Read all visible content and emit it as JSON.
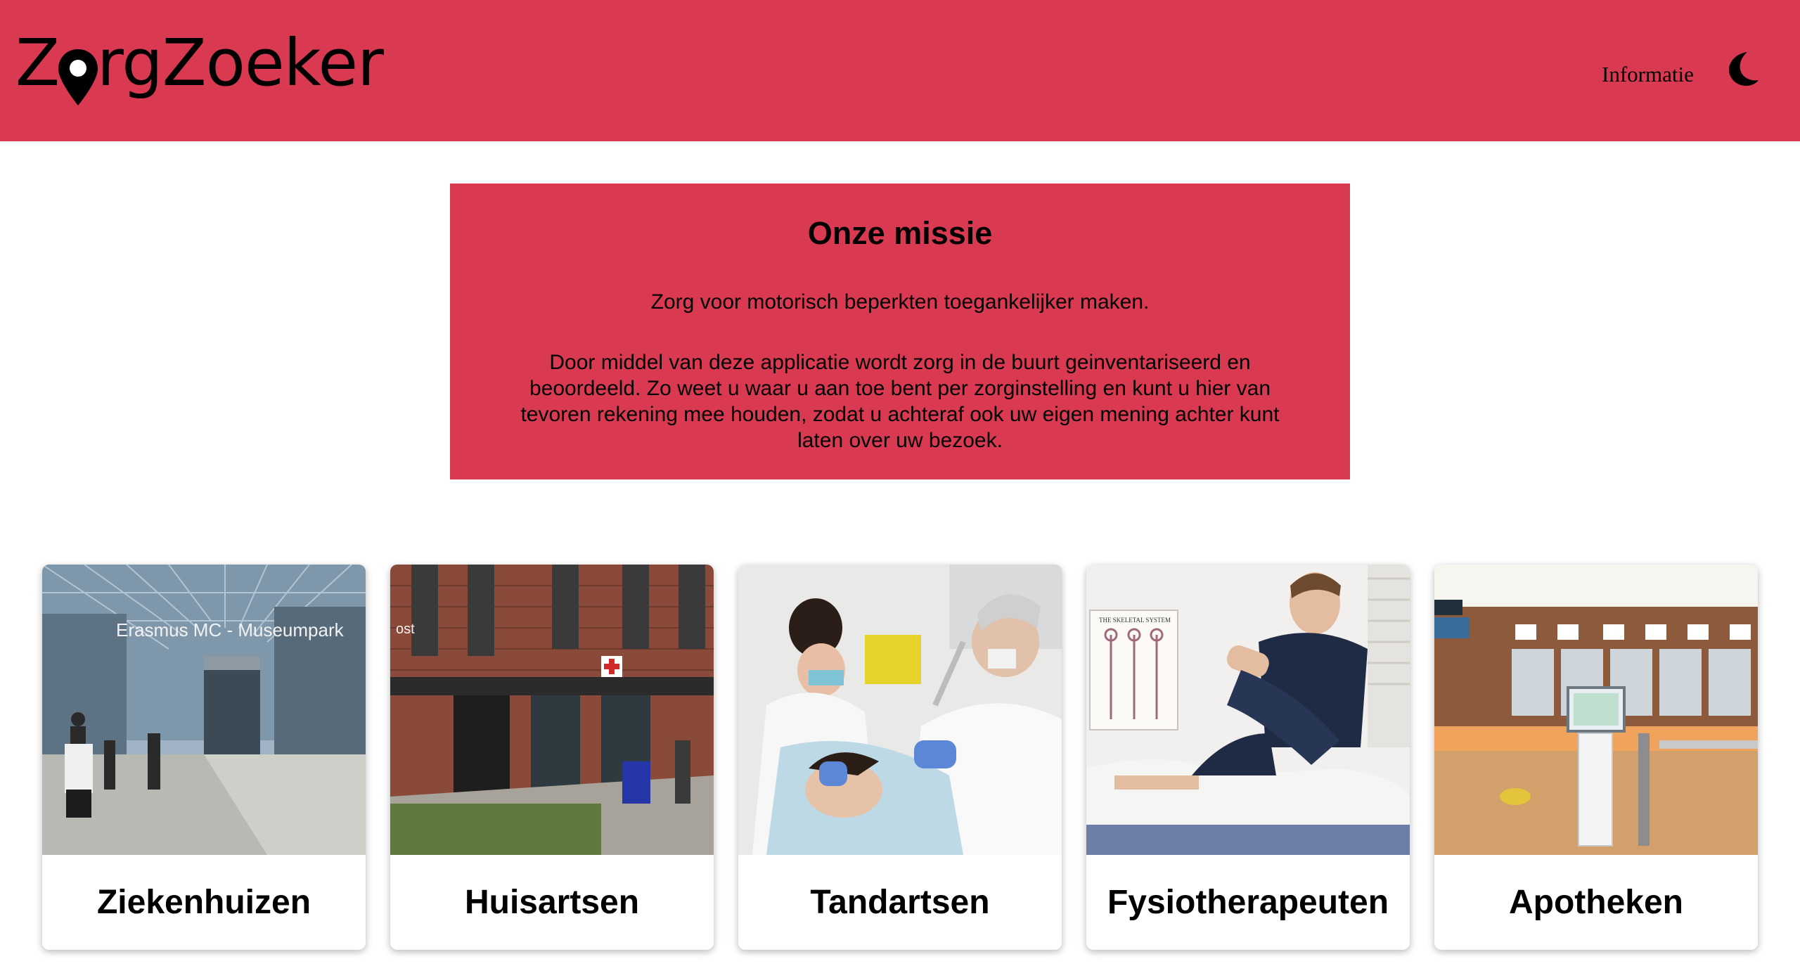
{
  "header": {
    "logo_prefix": "Z",
    "logo_suffix": "rgZoeker",
    "nav_info": "Informatie",
    "theme_icon": "moon-icon",
    "background": "#d93a52"
  },
  "mission": {
    "title": "Onze missie",
    "lead": "Zorg voor motorisch beperkten toegankelijker maken.",
    "body": "Door middel van deze applicatie wordt zorg in de buurt geinventariseerd en beoordeeld. Zo weet u waar u aan toe bent per zorginstelling en kunt u hier van tevoren rekening mee houden, zodat u achteraf ook uw eigen mening achter kunt laten over uw bezoek."
  },
  "cards": [
    {
      "label": "Ziekenhuizen",
      "photo_sign": "Erasmus MC - Museumpark"
    },
    {
      "label": "Huisartsen",
      "photo_sign": "ost"
    },
    {
      "label": "Tandartsen"
    },
    {
      "label": "Fysiotherapeuten",
      "photo_sign": "THE SKELETAL SYSTEM"
    },
    {
      "label": "Apotheken"
    }
  ]
}
